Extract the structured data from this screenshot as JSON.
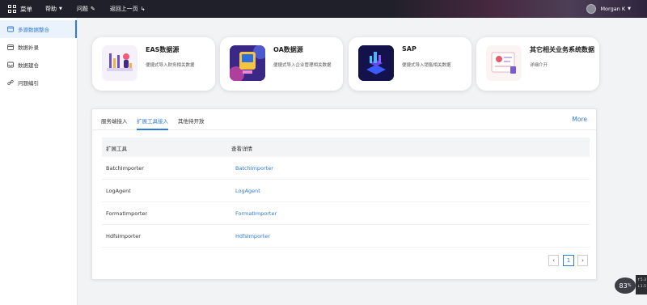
{
  "topbar": {
    "menu": "菜单",
    "help": "帮助",
    "question": "问题",
    "back": "返回上一页",
    "user": "Morgan K"
  },
  "sidebar": {
    "items": [
      {
        "label": "多源数据整合",
        "icon": "database-icon",
        "active": true
      },
      {
        "label": "数据补录",
        "icon": "calendar-icon",
        "active": false
      },
      {
        "label": "数据建仓",
        "icon": "inbox-icon",
        "active": false
      },
      {
        "label": "问题编引",
        "icon": "link-icon",
        "active": false
      }
    ]
  },
  "cards": [
    {
      "title": "EAS数据源",
      "desc": "便捷式导入财务相关数据"
    },
    {
      "title": "OA数据源",
      "desc": "便捷式导入企业管理相关数据"
    },
    {
      "title": "SAP",
      "desc": "便捷式导入销售相关数据"
    },
    {
      "title": "其它相关业务系统数据",
      "desc": "详细介开"
    }
  ],
  "tabs": [
    {
      "label": "服务端接入",
      "active": false
    },
    {
      "label": "扩展工具接入",
      "active": true
    },
    {
      "label": "其他待开放",
      "active": false
    }
  ],
  "more_label": "More",
  "table": {
    "headers": [
      "扩展工具",
      "查看详情"
    ],
    "rows": [
      [
        "BatchImporter",
        "BatchImporter"
      ],
      [
        "LogAgent",
        "LogAgent"
      ],
      [
        "FormatImporter",
        "FormatImporter"
      ],
      [
        "HdfsImporter",
        "HdfsImporter"
      ]
    ]
  },
  "pagination": {
    "prev": "‹",
    "page": "1",
    "next": "›"
  },
  "speed_widget": {
    "value": "83",
    "unit": "%",
    "up": "5.3",
    "down": "1.5"
  },
  "colors": {
    "accent": "#2f7bd6",
    "topbar": "#1f2029"
  }
}
